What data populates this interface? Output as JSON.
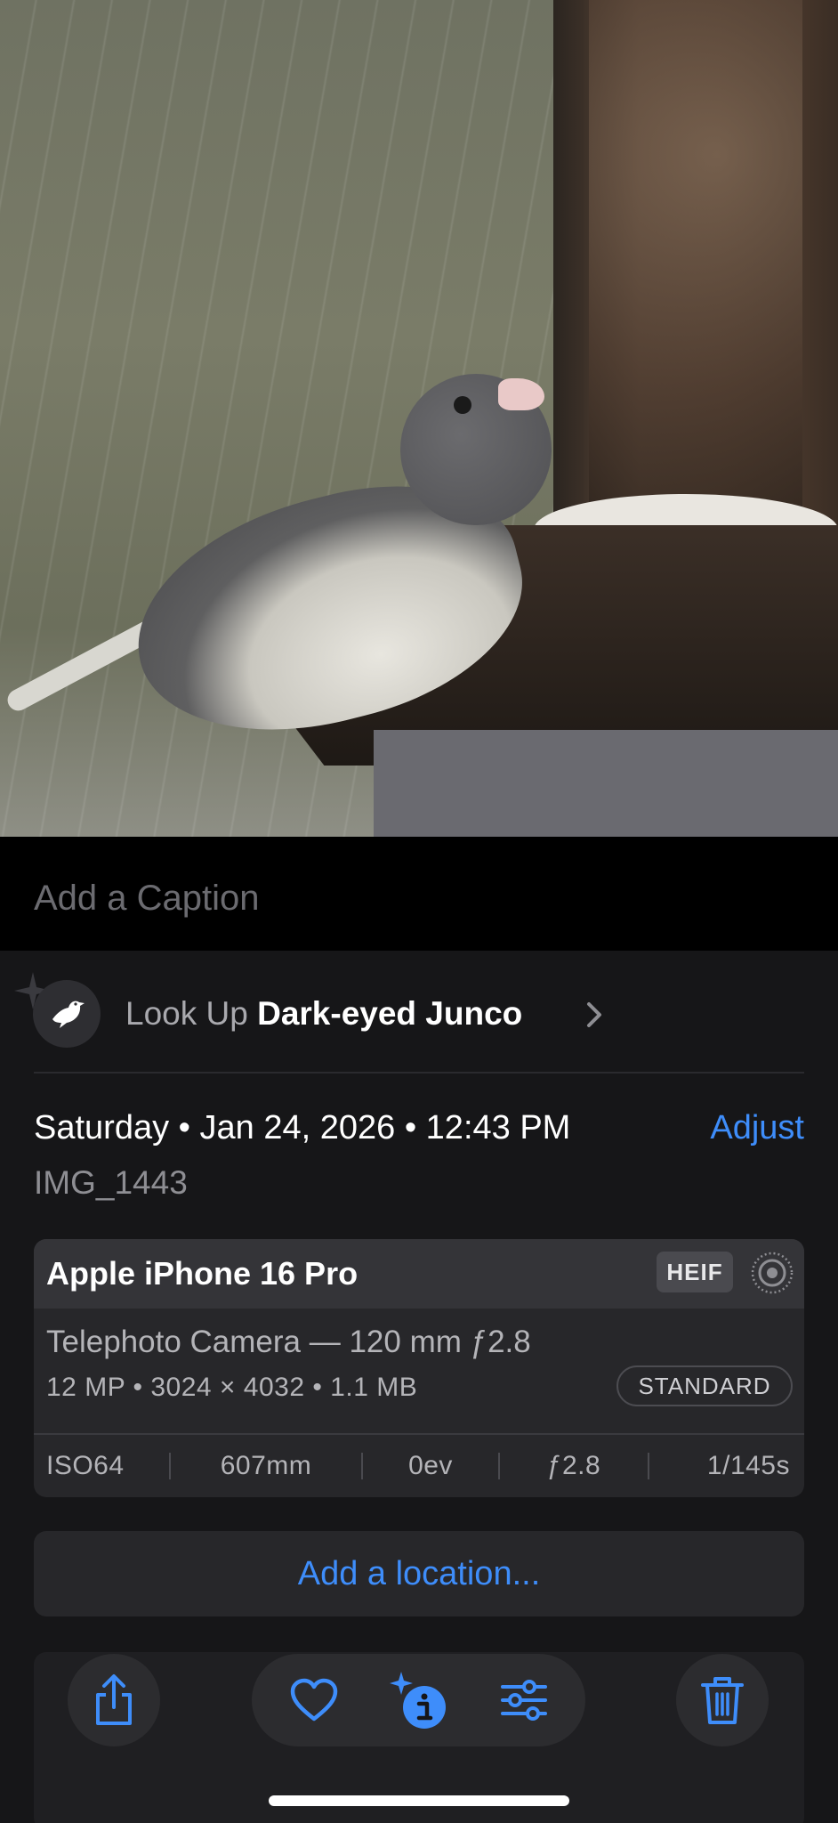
{
  "photo": {
    "subject": "dark-eyed-junco-photo"
  },
  "caption": {
    "placeholder": "Add a Caption",
    "value": ""
  },
  "lookup": {
    "prefix": "Look Up",
    "species": "Dark-eyed Junco",
    "icon": "bird-icon"
  },
  "details": {
    "date": "Saturday • Jan 24, 2026 • 12:43 PM",
    "adjust_label": "Adjust",
    "filename": "IMG_1443"
  },
  "camera": {
    "device": "Apple iPhone 16 Pro",
    "format_badge": "HEIF",
    "lens": "Telephoto Camera — 120 mm ƒ2.8",
    "specs": "12 MP • 3024 × 4032 • 1.1 MB",
    "mode_badge": "STANDARD",
    "exif": {
      "iso": "ISO64",
      "focal": "607mm",
      "ev": "0ev",
      "aperture": "ƒ2.8",
      "shutter": "1/145s"
    }
  },
  "location": {
    "label": "Add a location..."
  },
  "toolbar": {
    "share_icon": "share-icon",
    "favorite_icon": "heart-icon",
    "info_icon": "info-sparkle-icon",
    "adjust_icon": "sliders-icon",
    "delete_icon": "trash-icon"
  },
  "colors": {
    "accent": "#3e8dfa",
    "panel": "#161618",
    "card": "#27272a"
  }
}
